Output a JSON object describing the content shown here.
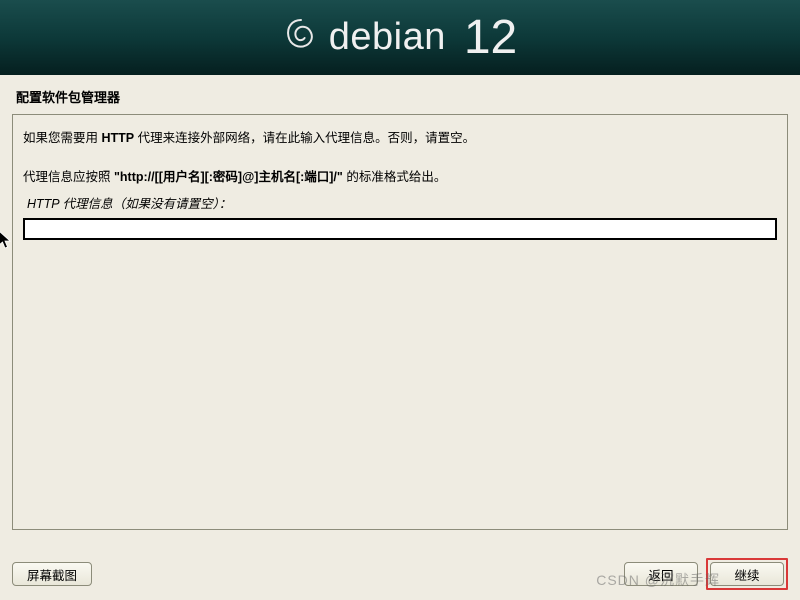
{
  "header": {
    "brand": "debian",
    "version": "12"
  },
  "section_title": "配置软件包管理器",
  "panel": {
    "line1_a": "如果您需要用 ",
    "line1_b": "HTTP",
    "line1_c": " 代理来连接外部网络，请在此输入代理信息。否则，请置空。",
    "line2_a": "代理信息应按照 ",
    "line2_b": "\"http://[[用户名][:密码]@]主机名[:端口]/\"",
    "line2_c": " 的标准格式给出。",
    "field_label": "HTTP 代理信息（如果没有请置空）：",
    "input_value": ""
  },
  "buttons": {
    "screenshot": "屏幕截图",
    "back": "返回",
    "continue": "继续"
  },
  "watermark": "CSDN @沉默手辉"
}
